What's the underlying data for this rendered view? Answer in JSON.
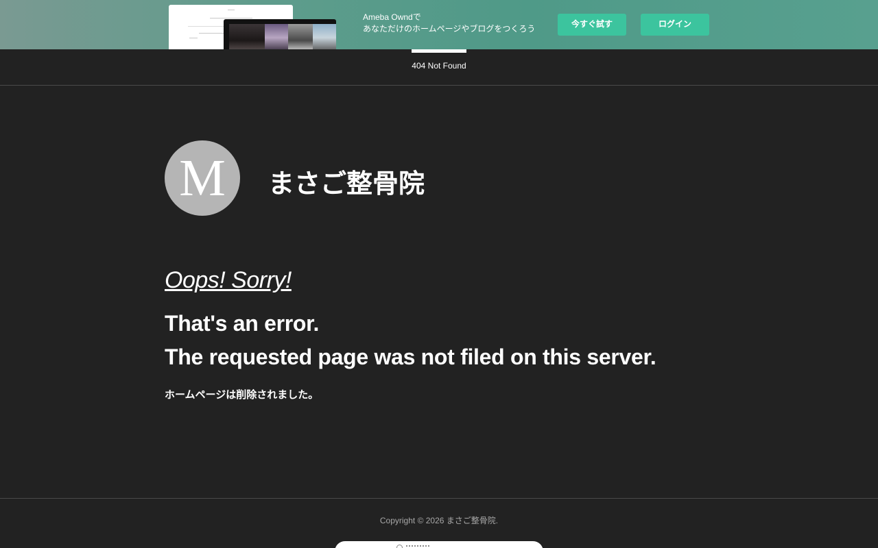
{
  "banner": {
    "line1": "Ameba Owndで",
    "line2": "あなただけのホームページやブログをつくろう",
    "try_label": "今すぐ試す",
    "login_label": "ログイン",
    "bg_color": "#58a08f",
    "button_color": "#3cc49e"
  },
  "header": {
    "breadcrumb": "404 Not Found"
  },
  "site": {
    "logo_letter": "M",
    "title": "まさご整骨院"
  },
  "error": {
    "oops": "Oops! Sorry!",
    "line1": "That's an error.",
    "line2": "The requested page was not filed on this server.",
    "note": "ホームページは削除されました。"
  },
  "footer": {
    "copyright": "Copyright © 2026 まさご整骨院."
  },
  "colors": {
    "page_bg": "#222222",
    "logo_bg": "#b5b5b5"
  }
}
